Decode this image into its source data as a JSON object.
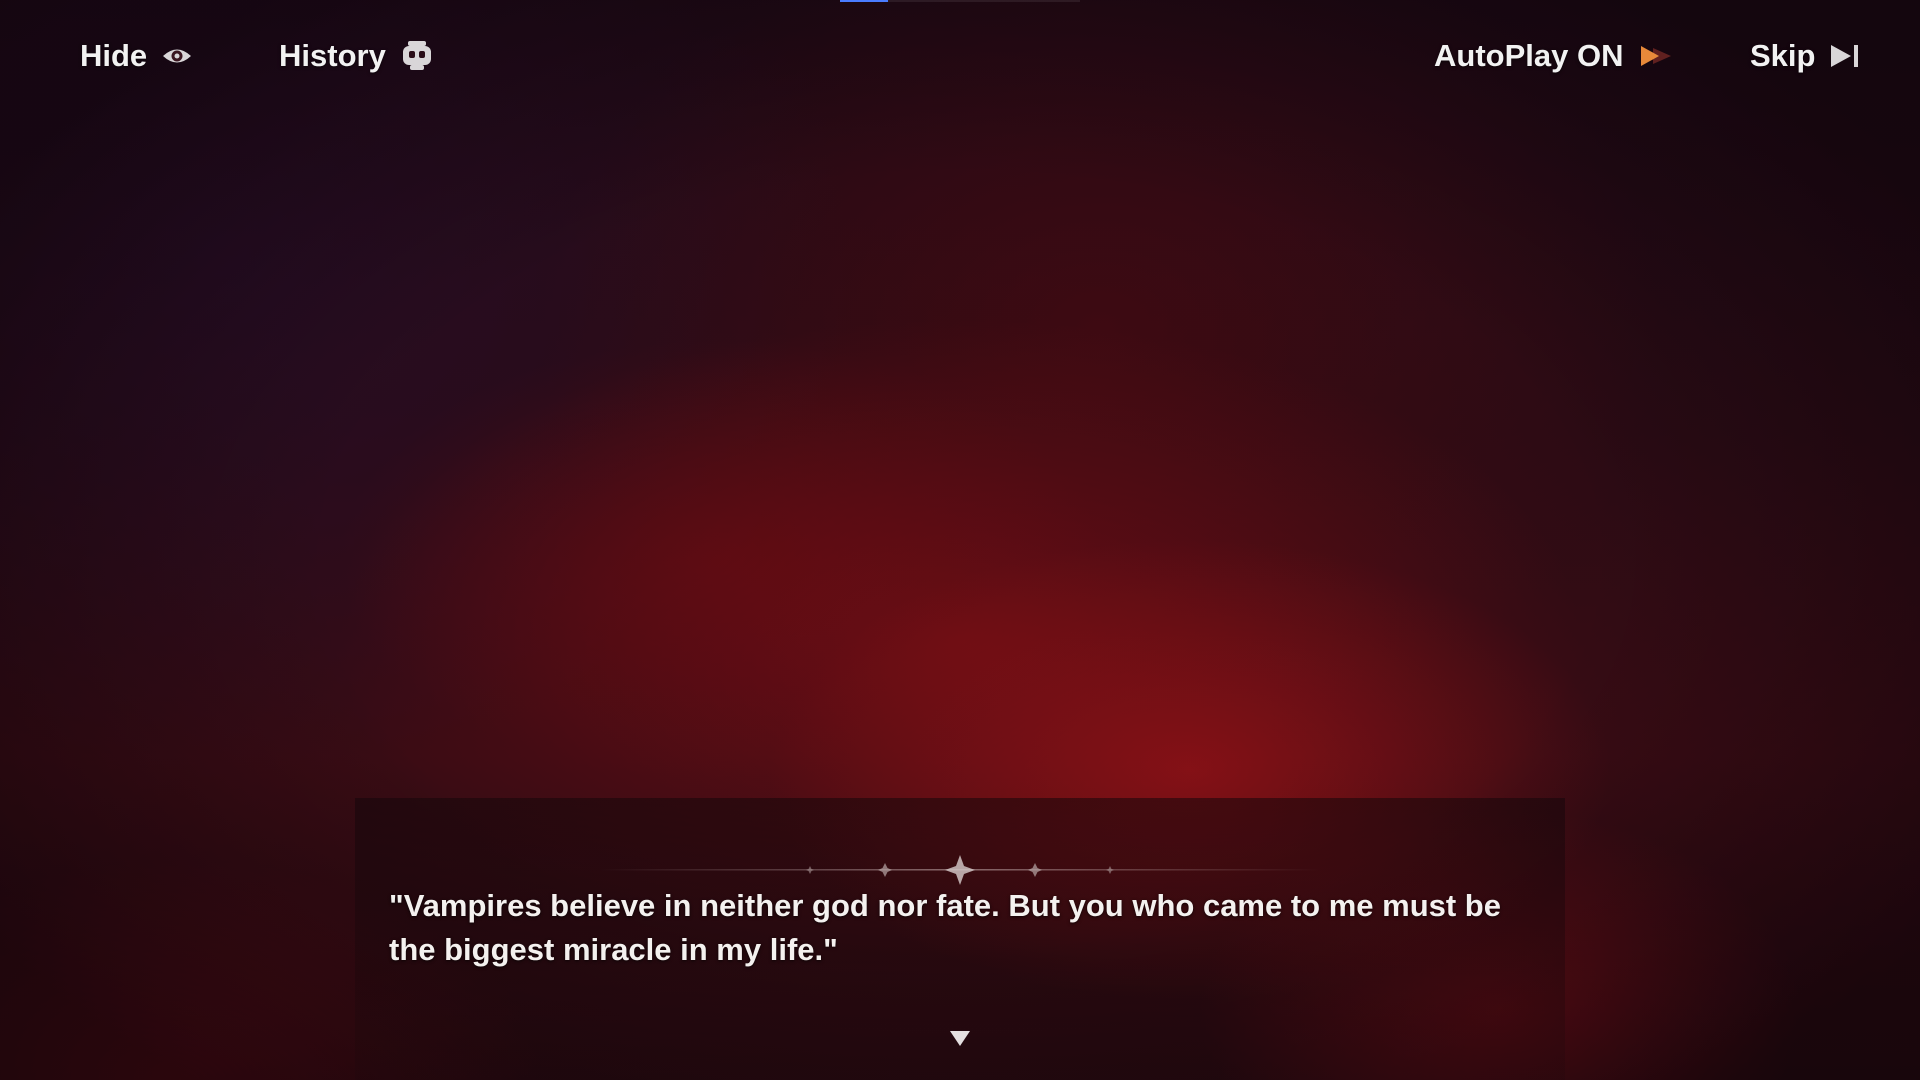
{
  "toolbar": {
    "hide_label": "Hide",
    "history_label": "History",
    "autoplay_label": "AutoPlay ON",
    "skip_label": "Skip"
  },
  "icons": {
    "hide": "eye-icon",
    "history": "history-icon",
    "autoplay": "autoplay-icon",
    "skip": "skip-icon",
    "advance": "triangle-down-icon"
  },
  "colors": {
    "autoplay_accent": "#e8893a",
    "text": "#f4f1ef",
    "progress_accent": "#4a7cff"
  },
  "progress": {
    "fraction": 0.2
  },
  "dialogue": {
    "line1": "\"Vampires believe in neither god nor fate. But you who came to me must be",
    "line2": "the biggest miracle in my life.\""
  }
}
